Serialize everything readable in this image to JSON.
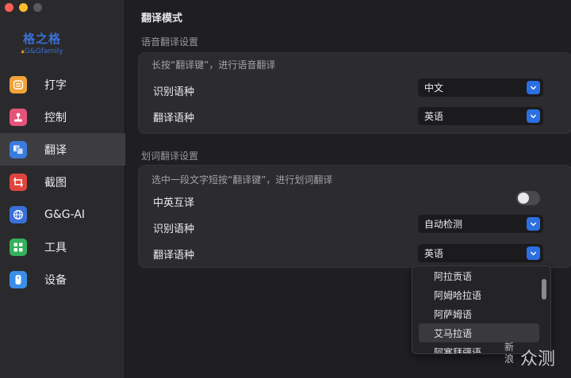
{
  "window": {
    "controls": [
      "close",
      "minimize",
      "maximize"
    ]
  },
  "logo": {
    "name_cn": "格之格",
    "name_en": "G&Gfamily"
  },
  "sidebar": {
    "items": [
      {
        "label": "打字",
        "icon": "keyboard-icon",
        "color": "#f2a23a",
        "active": false
      },
      {
        "label": "控制",
        "icon": "joystick-icon",
        "color": "#e5527a",
        "active": false
      },
      {
        "label": "翻译",
        "icon": "translate-icon",
        "color": "#3a7be0",
        "active": true
      },
      {
        "label": "截图",
        "icon": "screenshot-icon",
        "color": "#e0453d",
        "active": false
      },
      {
        "label": "G&G-AI",
        "icon": "globe-icon",
        "color": "#3a6fd8",
        "active": false
      },
      {
        "label": "工具",
        "icon": "tools-icon",
        "color": "#34b15a",
        "active": false
      },
      {
        "label": "设备",
        "icon": "device-icon",
        "color": "#3a8ee8",
        "active": false
      }
    ]
  },
  "main": {
    "title": "翻译模式",
    "voice": {
      "section_title": "语音翻译设置",
      "hint": "长按“翻译键”，进行语音翻译",
      "source_label": "识别语种",
      "source_value": "中文",
      "target_label": "翻译语种",
      "target_value": "英语"
    },
    "word": {
      "section_title": "划词翻译设置",
      "hint": "选中一段文字短按“翻译键”，进行划词翻译",
      "toggle_label": "中英互译",
      "toggle_on": false,
      "source_label": "识别语种",
      "source_value": "自动检测",
      "target_label": "翻译语种",
      "target_value": "英语"
    },
    "dropdown": {
      "options": [
        "阿拉贡语",
        "阿姆哈拉语",
        "阿萨姆语",
        "艾马拉语",
        "阿塞拜疆语"
      ],
      "highlighted_index": 3
    }
  },
  "watermark": {
    "vertical": "新浪",
    "text": "众测"
  },
  "colors": {
    "accent": "#2c6fe0",
    "logo": "#3b6fd8"
  }
}
